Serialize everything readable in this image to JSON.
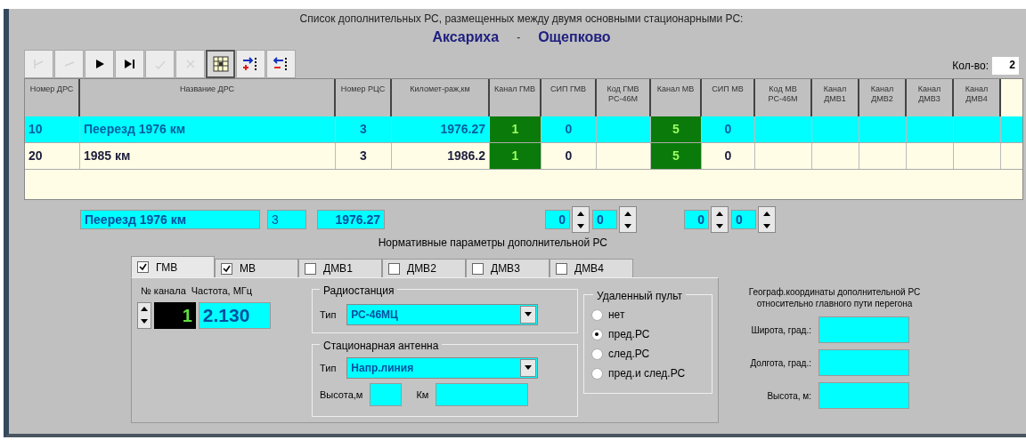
{
  "header": {
    "caption": "Список дополнительных РС, размещенных между двумя основными стационарными РС:",
    "station_a": "Аксариха",
    "separator": "-",
    "station_b": "Ощепково"
  },
  "toolbar": [
    {
      "kind": "first",
      "disabled": true,
      "pressed": false
    },
    {
      "kind": "prior",
      "disabled": true,
      "pressed": false
    },
    {
      "kind": "next",
      "disabled": false,
      "pressed": false
    },
    {
      "kind": "last",
      "disabled": false,
      "pressed": false
    },
    {
      "kind": "post",
      "disabled": true,
      "pressed": false
    },
    {
      "kind": "cancel",
      "disabled": true,
      "pressed": false
    },
    {
      "kind": "grid",
      "disabled": false,
      "pressed": true
    },
    {
      "kind": "insert",
      "disabled": false,
      "pressed": false
    },
    {
      "kind": "delete",
      "disabled": false,
      "pressed": false
    }
  ],
  "count": {
    "label": "Кол-во:",
    "value": "2"
  },
  "table": {
    "columns": [
      {
        "label": "Номер ДРС",
        "kind": "text"
      },
      {
        "label": "Название ДРС",
        "kind": "text"
      },
      {
        "label": "Номер РЦС",
        "kind": "text"
      },
      {
        "label": "Километ-раж,км",
        "kind": "text"
      },
      {
        "label": "Канал ГМВ",
        "kind": "channel"
      },
      {
        "label": "СИП ГМВ",
        "kind": "text"
      },
      {
        "label": "Код ГМВ РС-46М",
        "kind": "text"
      },
      {
        "label": "Канал МВ",
        "kind": "channel"
      },
      {
        "label": "СИП МВ",
        "kind": "text"
      },
      {
        "label": "Код МВ РС-46М",
        "kind": "text"
      },
      {
        "label": "Канал ДМВ1",
        "kind": "text"
      },
      {
        "label": "Канал ДМВ2",
        "kind": "text"
      },
      {
        "label": "Канал ДМВ3",
        "kind": "text"
      },
      {
        "label": "Канал ДМВ4",
        "kind": "text"
      }
    ],
    "rows": [
      {
        "selected": true,
        "cells": [
          "10",
          "Пеерезд 1976 км",
          "3",
          "1976.27",
          "1",
          "0",
          "",
          "5",
          "0",
          "",
          "",
          "",
          "",
          ""
        ]
      },
      {
        "selected": false,
        "cells": [
          "20",
          "1985 км",
          "3",
          "1986.2",
          "1",
          "0",
          "",
          "5",
          "0",
          "",
          "",
          "",
          "",
          ""
        ]
      }
    ]
  },
  "editor": {
    "name": "Пеерезд 1976 км",
    "rcs": "3",
    "km": "1976.27",
    "spinners": [
      "0",
      "0",
      "0",
      "0"
    ]
  },
  "norms_title": "Нормативные параметры дополнительной РС",
  "tabs": [
    {
      "label": "ГМВ",
      "checked": true,
      "selected": true
    },
    {
      "label": "МВ",
      "checked": true,
      "selected": false
    },
    {
      "label": "ДМВ1",
      "checked": false,
      "selected": false
    },
    {
      "label": "ДМВ2",
      "checked": false,
      "selected": false
    },
    {
      "label": "ДМВ3",
      "checked": false,
      "selected": false
    },
    {
      "label": "ДМВ4",
      "checked": false,
      "selected": false
    }
  ],
  "channel": {
    "number_label": "№ канала",
    "frequency_label": "Частота, МГц",
    "number": "1",
    "frequency": "2.130"
  },
  "radio_station": {
    "title": "Радиостанция",
    "type_label": "Тип",
    "type": "РС-46МЦ"
  },
  "antenna": {
    "title": "Стационарная антенна",
    "type_label": "Тип",
    "type": "Напр.линия",
    "height_label": "Высота,м",
    "km_label": "Км"
  },
  "remote": {
    "title": "Удаленный пульт",
    "options": [
      {
        "label": "нет",
        "selected": false
      },
      {
        "label": "пред.РС",
        "selected": true
      },
      {
        "label": "след.РС",
        "selected": false
      },
      {
        "label": "пред.и след.РС",
        "selected": false
      }
    ]
  },
  "geo": {
    "caption": "Географ.координаты дополнительной РС относительно главного пути перегона",
    "fields": [
      {
        "label": "Широта, град.:"
      },
      {
        "label": "Долгота, град.:"
      },
      {
        "label": "Высота, м:"
      }
    ]
  }
}
